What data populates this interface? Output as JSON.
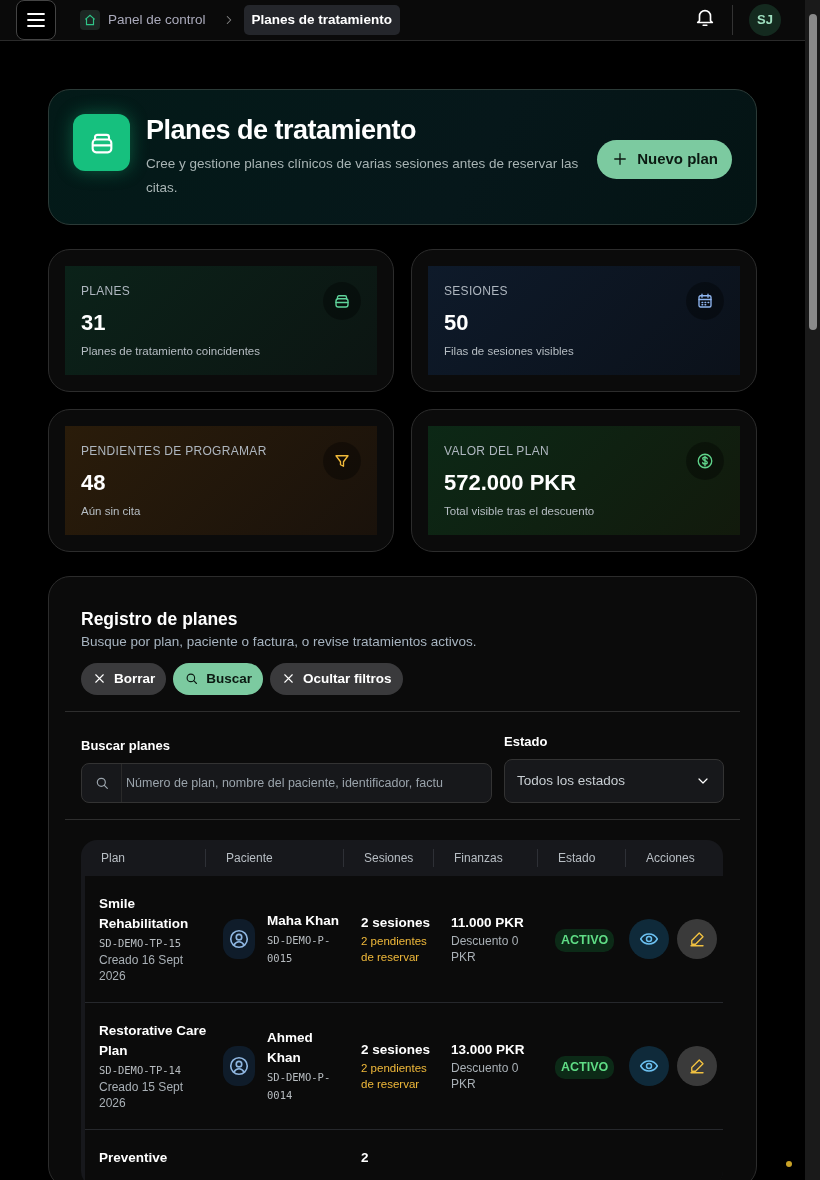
{
  "topbar": {
    "breadcrumbs": [
      {
        "label": "Panel de control",
        "selected": false
      },
      {
        "label": "Planes de tratamiento",
        "selected": true
      }
    ],
    "avatar": "SJ"
  },
  "hero": {
    "title": "Planes de tratamiento",
    "description": "Cree y gestione planes clínicos de varias sesiones antes de reservar las citas.",
    "button": "Nuevo plan"
  },
  "stats": [
    {
      "kind": "plans",
      "label": "PLANES",
      "value": "31",
      "caption": "Planes de tratamiento coincidentes"
    },
    {
      "kind": "sessions",
      "label": "SESIONES",
      "value": "50",
      "caption": "Filas de sesiones visibles"
    },
    {
      "kind": "pending",
      "label": "PENDIENTES DE PROGRAMAR",
      "value": "48",
      "caption": "Aún sin cita"
    },
    {
      "kind": "value",
      "label": "VALOR DEL PLAN",
      "value": "572.000 PKR",
      "caption": "Total visible tras el descuento"
    }
  ],
  "registry": {
    "title": "Registro de planes",
    "description": "Busque por plan, paciente o factura, o revise tratamientos activos.",
    "actions": [
      {
        "kind": "clear",
        "label": "Borrar"
      },
      {
        "kind": "search",
        "label": "Buscar"
      },
      {
        "kind": "hide",
        "label": "Ocultar filtros"
      }
    ],
    "search": {
      "label": "Buscar planes",
      "placeholder": "Número de plan, nombre del paciente, identificador, factu"
    },
    "status_filter": {
      "label": "Estado",
      "value": "Todos los estados"
    }
  },
  "table": {
    "columns": [
      "Plan",
      "Paciente",
      "Sesiones",
      "Finanzas",
      "Estado",
      "Acciones"
    ],
    "rows": [
      {
        "plan": "Smile Rehabilitation",
        "code": "SD-DEMO-TP-15",
        "created": "Creado 16 Sept 2026",
        "patient": "Maha Khan",
        "patient_id": "SD-DEMO-P-0015",
        "sessions": "2 sesiones",
        "pending": "2 pendientes de reservar",
        "amount": "11.000 PKR",
        "discount": "Descuento 0 PKR",
        "status": "ACTIVO"
      },
      {
        "plan": "Restorative Care Plan",
        "code": "SD-DEMO-TP-14",
        "created": "Creado 15 Sept 2026",
        "patient": "Ahmed Khan",
        "patient_id": "SD-DEMO-P-0014",
        "sessions": "2 sesiones",
        "pending": "2 pendientes de reservar",
        "amount": "13.000 PKR",
        "discount": "Descuento 0 PKR",
        "status": "ACTIVO"
      },
      {
        "plan": "Preventive",
        "sessions": "2"
      }
    ]
  }
}
